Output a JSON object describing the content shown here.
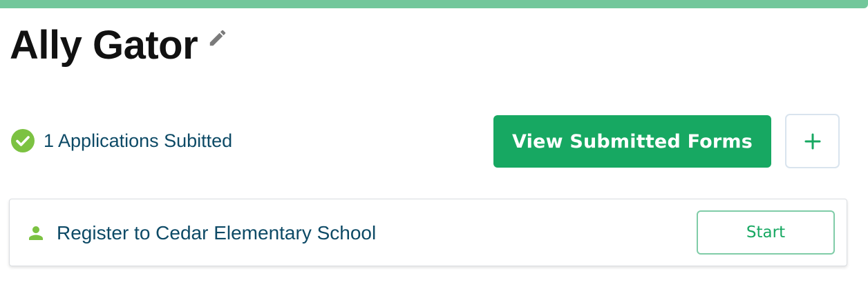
{
  "header": {
    "name": "Ally Gator",
    "edit_icon": "pencil-icon"
  },
  "status": {
    "icon": "check-circle-icon",
    "text": "1 Applications Subitted"
  },
  "actions": {
    "view_forms_label": "View Submitted Forms",
    "add_label": "+",
    "add_icon": "plus-icon"
  },
  "forms": [
    {
      "icon": "person-icon",
      "title": "Register to Cedar Elementary School",
      "action_label": "Start"
    }
  ],
  "colors": {
    "accent_bar": "#72c79b",
    "primary_green": "#17a862",
    "status_check": "#7cc242",
    "text_navy": "#0d4a66",
    "heading": "#111111"
  }
}
